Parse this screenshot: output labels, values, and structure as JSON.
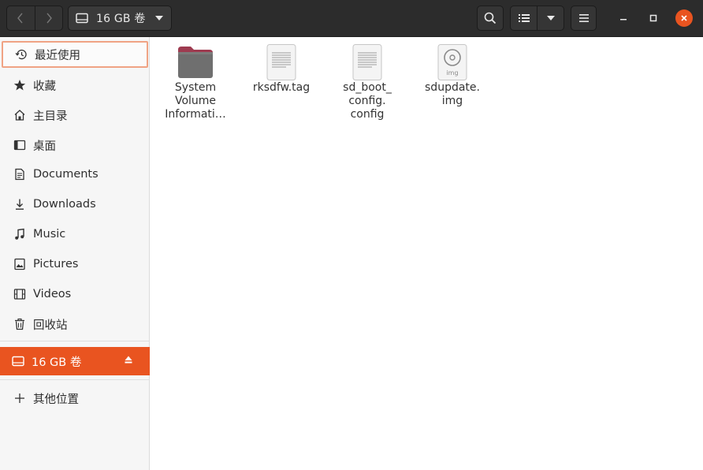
{
  "header": {
    "path_label": "16 GB 卷",
    "back_icon": "chevron-left-icon",
    "forward_icon": "chevron-right-icon",
    "search_icon": "search-icon",
    "list_view_icon": "list-view-icon",
    "view_menu_icon": "caret-down-icon",
    "menu_icon": "hamburger-menu-icon",
    "accent": "#e95420"
  },
  "sidebar": {
    "items": [
      {
        "label": "最近使用",
        "icon": "recent-icon"
      },
      {
        "label": "收藏",
        "icon": "star-icon"
      },
      {
        "label": "主目录",
        "icon": "home-icon"
      },
      {
        "label": "桌面",
        "icon": "desktop-icon"
      },
      {
        "label": "Documents",
        "icon": "documents-icon"
      },
      {
        "label": "Downloads",
        "icon": "downloads-icon"
      },
      {
        "label": "Music",
        "icon": "music-icon"
      },
      {
        "label": "Pictures",
        "icon": "pictures-icon"
      },
      {
        "label": "Videos",
        "icon": "videos-icon"
      },
      {
        "label": "回收站",
        "icon": "trash-icon"
      }
    ],
    "drive": {
      "label": "16 GB 卷",
      "icon": "drive-icon",
      "eject_icon": "eject-icon"
    },
    "other": {
      "label": "其他位置",
      "icon": "plus-icon"
    }
  },
  "files": [
    {
      "name": "System\nVolume\nInformati…",
      "type": "folder"
    },
    {
      "name": "rksdfw.tag",
      "type": "text"
    },
    {
      "name": "sd_boot_\nconfig.\nconfig",
      "type": "text"
    },
    {
      "name": "sdupdate.\nimg",
      "type": "disk-image",
      "badge": "img"
    }
  ]
}
